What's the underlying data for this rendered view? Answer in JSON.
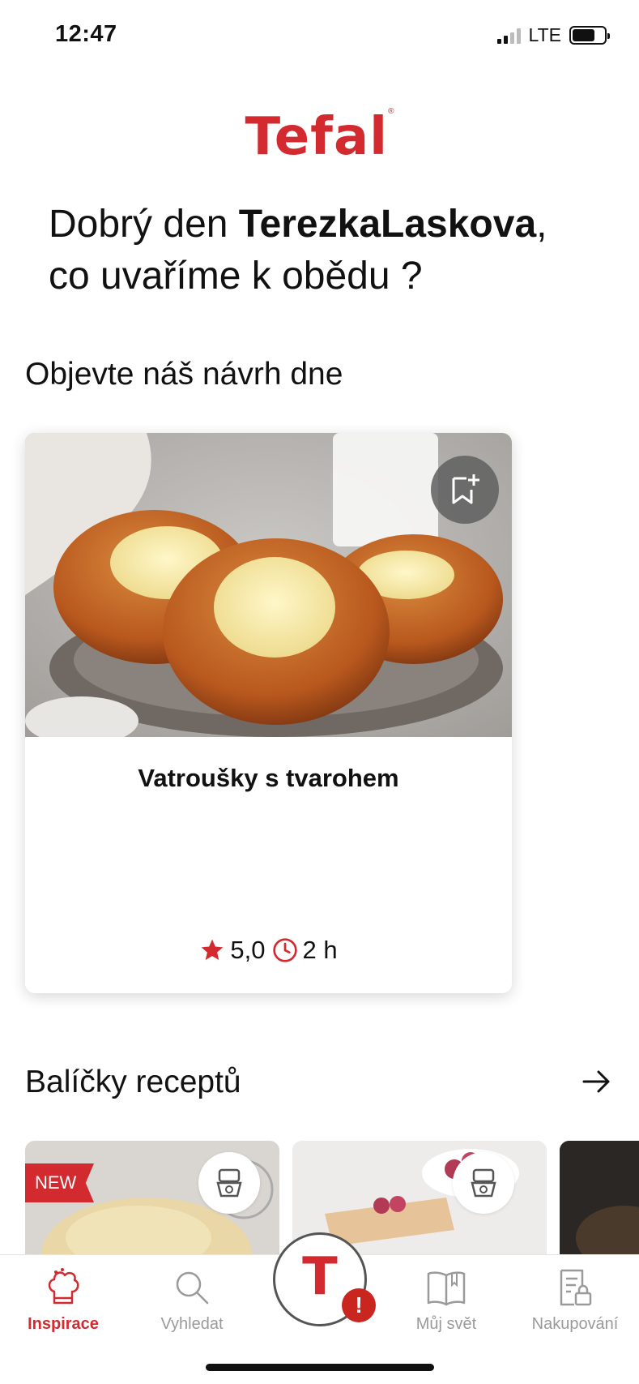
{
  "status": {
    "time": "12:47",
    "network": "LTE"
  },
  "brand": {
    "logo": "Tefal",
    "color": "#d32a2f"
  },
  "greeting": {
    "prefix": "Dobrý den ",
    "username": "TerezkaLaskova",
    "suffix": ",",
    "line2": "co uvaříme k obědu ?"
  },
  "daily": {
    "section_title": "Objevte náš návrh dne",
    "recipe": {
      "title": "Vatroušky s tvarohem",
      "rating": "5,0",
      "time": "2 h",
      "rating_icon": "star-icon",
      "time_icon": "clock-icon",
      "bookmark_icon": "bookmark-add-icon"
    }
  },
  "packs": {
    "section_title": "Balíčky receptů",
    "arrow_icon": "arrow-right-icon",
    "items": [
      {
        "badge": "NEW",
        "device_icon": "food-processor-icon"
      },
      {
        "device_icon": "food-processor-icon"
      },
      {}
    ]
  },
  "tabbar": {
    "items": [
      {
        "label": "Inspirace",
        "icon": "chef-hat-icon",
        "active": true
      },
      {
        "label": "Vyhledat",
        "icon": "search-icon"
      },
      {
        "label": "Můj svět",
        "icon": "book-icon"
      },
      {
        "label": "Nakupování",
        "icon": "shopping-list-icon"
      }
    ],
    "center": {
      "logo": "T",
      "alert": "!"
    }
  }
}
